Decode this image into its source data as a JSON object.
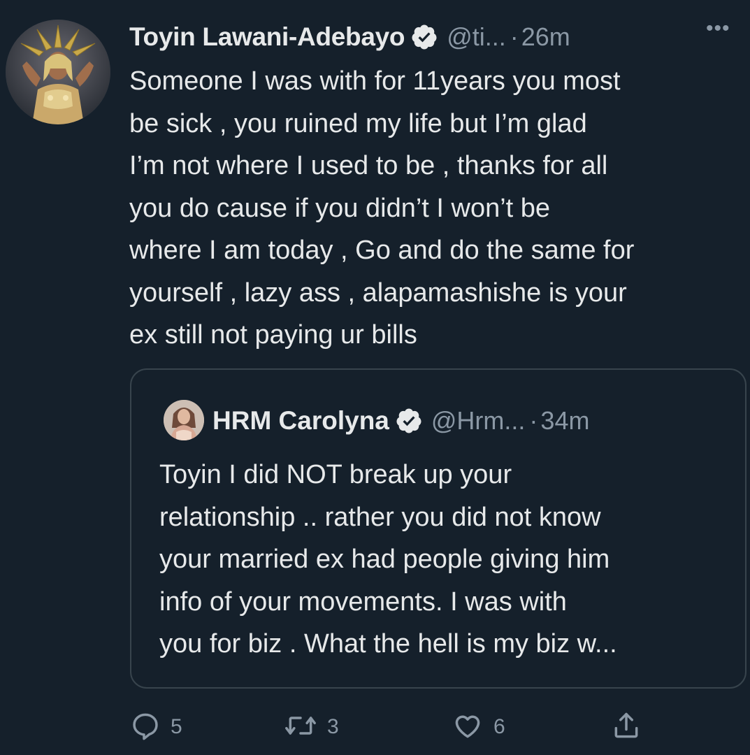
{
  "tweet": {
    "author_name": "Toyin Lawani-Adebayo",
    "handle": "@ti...",
    "separator": "·",
    "time": "26m",
    "more_label": "•••",
    "text": "Someone I was with for 11years you most\nbe sick , you ruined my life but I’m glad\nI’m not where I used to be , thanks for all\nyou do cause if you didn’t I won’t be\nwhere I am today , Go and do the same for\nyourself , lazy ass , alapamashishe is your\nex still not paying ur bills"
  },
  "quote": {
    "author_name": "HRM Carolyna",
    "handle": "@Hrm...",
    "separator": "·",
    "time": "34m",
    "text": "Toyin I did NOT break up your\nrelationship .. rather you did not know\nyour married ex had people giving him\ninfo of your movements. I was with\nyou for biz . What the hell is my biz w..."
  },
  "actions": {
    "reply_count": "5",
    "retweet_count": "3",
    "like_count": "6"
  },
  "icons": {
    "verified": "verified-badge-icon",
    "reply": "reply-icon",
    "retweet": "retweet-icon",
    "like": "heart-icon",
    "share": "share-icon",
    "more": "more-icon"
  },
  "colors": {
    "background": "#15202b",
    "text": "#e7e9ea",
    "secondary": "#8b98a5",
    "border": "#38444d"
  }
}
